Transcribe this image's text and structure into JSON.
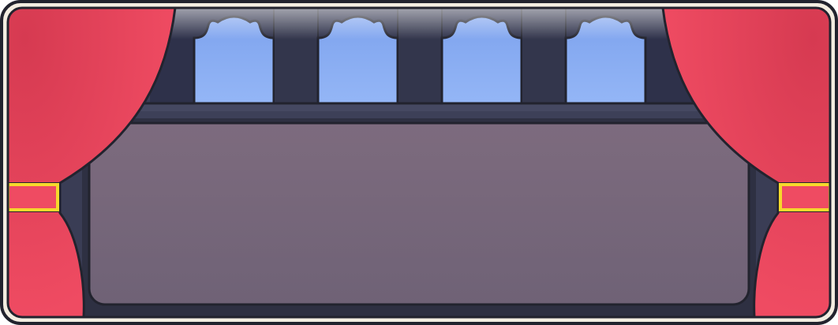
{
  "scene": {
    "name": "theater-stage-panel",
    "palette": {
      "frame_outer": "#f3ede1",
      "frame_stroke": "#22232e",
      "wall_dark": "#2e314a",
      "wall_mid": "#3c3f56",
      "column": "#33364c",
      "window_sky_top": "#7ea3ee",
      "window_sky_bottom": "#94b6f6",
      "ledge": "#454861",
      "stage_top": "#7d6b7e",
      "stage_bottom": "#6f6276",
      "stage_shadow": "#2a2c3d",
      "curtain": "#ef4b62",
      "curtain_dark": "#d9384f",
      "tieback_fill": "#ef4b62",
      "tieback_border": "#f7d92c"
    },
    "windows_count": 4,
    "icons": {
      "left_curtain": "curtain-left-icon",
      "right_curtain": "curtain-right-icon",
      "window": "arched-window-icon",
      "tieback": "curtain-tieback-icon"
    }
  }
}
